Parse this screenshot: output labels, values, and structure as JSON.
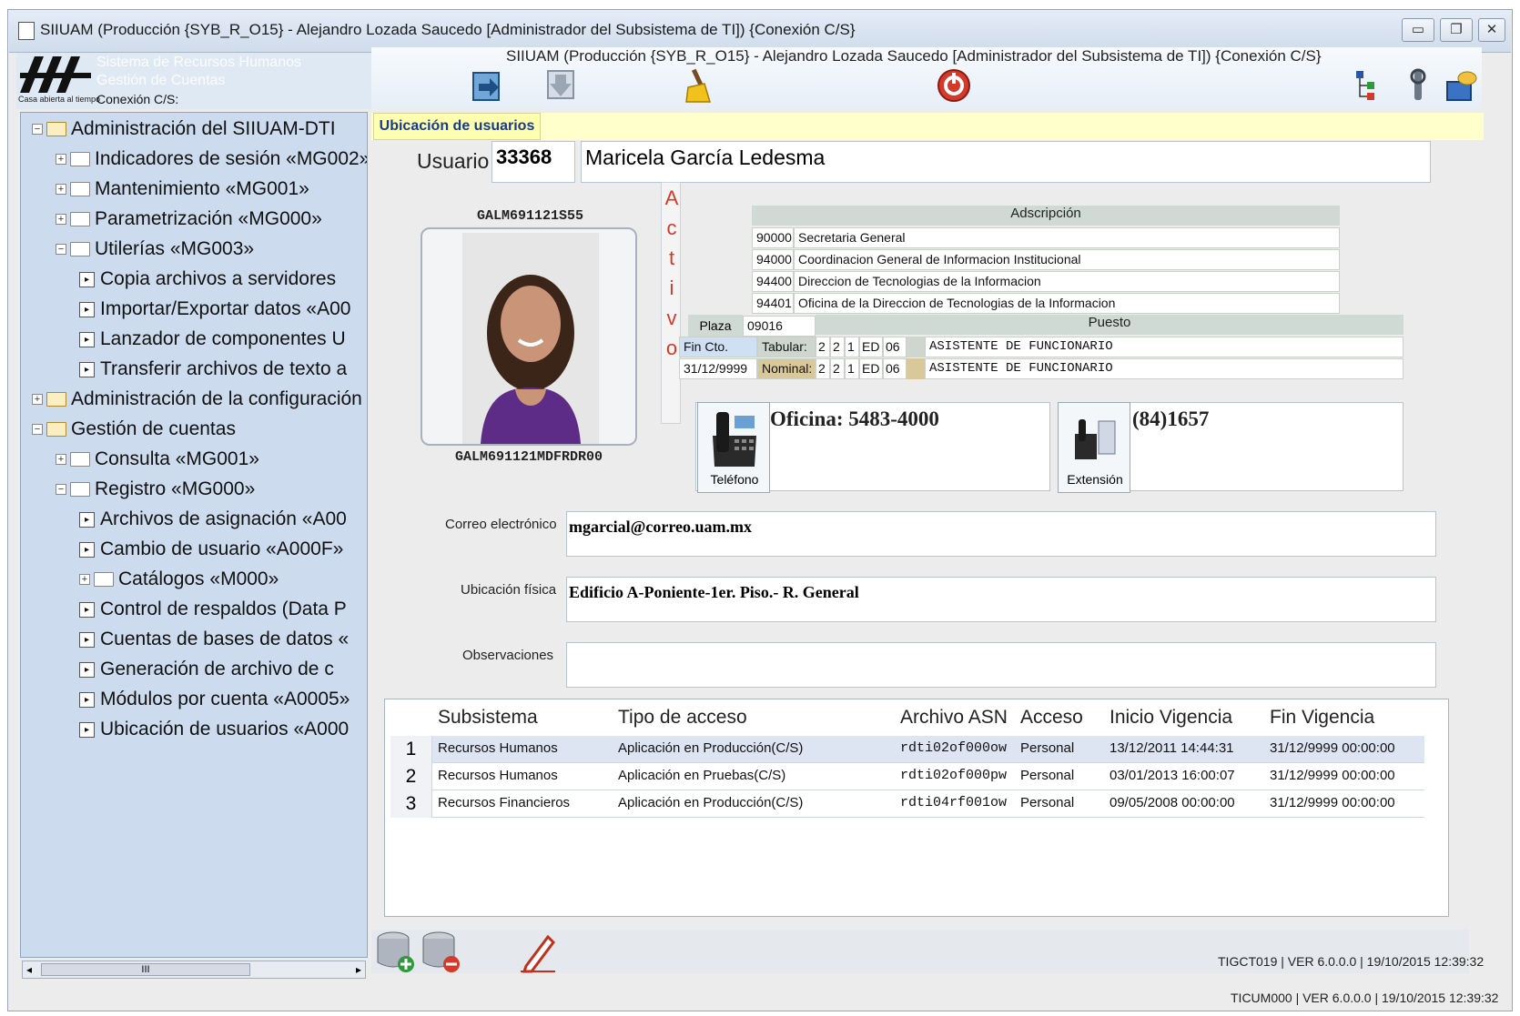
{
  "window": {
    "title": "SIIUAM (Producción {SYB_R_O15} - Alejandro Lozada Saucedo [Administrador del Subsistema de TI]) {Conexión C/S}",
    "controls": [
      "minimize-icon",
      "restore-icon",
      "close-icon"
    ]
  },
  "header": {
    "logo_sub": "Casa abierta al tiempo",
    "sistema": "Sistema de Recursos Humanos",
    "gestion": "Gestión de Cuentas",
    "conexion": "Conexión C/S:",
    "subtitle": "SIIUAM (Producción {SYB_R_O15} - Alejandro Lozada Saucedo [Administrador del Subsistema de TI]) {Conexión C/S}"
  },
  "toolbar": {
    "icons": [
      "import-icon",
      "export-icon",
      "broom-icon",
      "stop-icon",
      "tree-icon",
      "tools-icon",
      "network-icon"
    ]
  },
  "tree": [
    {
      "label": "Administración del SIIUAM-DTI",
      "level": 0,
      "type": "open-folder",
      "expander": "−"
    },
    {
      "label": "Indicadores de sesión «MG002»",
      "level": 1,
      "type": "folder",
      "expander": "+"
    },
    {
      "label": "Mantenimiento «MG001»",
      "level": 1,
      "type": "folder",
      "expander": "+"
    },
    {
      "label": "Parametrización «MG000»",
      "level": 1,
      "type": "folder",
      "expander": "+"
    },
    {
      "label": "Utilerías «MG003»",
      "level": 1,
      "type": "folder",
      "expander": "−"
    },
    {
      "label": "Copia archivos a servidores",
      "level": 2,
      "type": "leaf"
    },
    {
      "label": "Importar/Exportar datos «A00",
      "level": 2,
      "type": "leaf"
    },
    {
      "label": "Lanzador de componentes U",
      "level": 2,
      "type": "leaf"
    },
    {
      "label": "Transferir archivos de texto a",
      "level": 2,
      "type": "leaf"
    },
    {
      "label": "Administración de la configuración",
      "level": 0,
      "type": "open-folder",
      "expander": "+"
    },
    {
      "label": "Gestión de cuentas",
      "level": 0,
      "type": "open-folder",
      "expander": "−"
    },
    {
      "label": "Consulta «MG001»",
      "level": 1,
      "type": "folder",
      "expander": "+"
    },
    {
      "label": "Registro «MG000»",
      "level": 1,
      "type": "folder",
      "expander": "−"
    },
    {
      "label": "Archivos de asignación «A00",
      "level": 2,
      "type": "leaf"
    },
    {
      "label": "Cambio de usuario «A000F»",
      "level": 2,
      "type": "leaf"
    },
    {
      "label": "Catálogos «M000»",
      "level": 2,
      "type": "folder",
      "expander": "+"
    },
    {
      "label": "Control de respaldos (Data P",
      "level": 2,
      "type": "leaf"
    },
    {
      "label": "Cuentas de bases de datos «",
      "level": 2,
      "type": "leaf"
    },
    {
      "label": "Generación de archivo de c",
      "level": 2,
      "type": "leaf"
    },
    {
      "label": "Módulos por cuenta «A0005»",
      "level": 2,
      "type": "leaf"
    },
    {
      "label": "Ubicación de usuarios «A000",
      "level": 2,
      "type": "leaf"
    }
  ],
  "tab": {
    "label": "Ubicación de usuarios"
  },
  "usuario": {
    "label": "Usuario",
    "number": "33368",
    "name": "Maricela García Ledesma",
    "rfc": "GALM691121S55",
    "curp": "GALM691121MDFRDR00",
    "status_letters": [
      "A",
      "c",
      "t",
      "i",
      "v",
      "o"
    ]
  },
  "adscripcion": {
    "header": "Adscripción",
    "rows": [
      {
        "code": "90000",
        "name": "Secretaria General"
      },
      {
        "code": "94000",
        "name": "Coordinacion General de Informacion Institucional"
      },
      {
        "code": "94400",
        "name": "Direccion de Tecnologias de la Informacion"
      },
      {
        "code": "94401",
        "name": "Oficina de la Direccion de Tecnologias de la Informacion"
      }
    ]
  },
  "plaza": {
    "label": "Plaza",
    "value": "09016",
    "puesto_header": "Puesto",
    "fin_cto_label": "Fin Cto.",
    "fin_cto_value": "31/12/9999",
    "tabular_label": "Tabular:",
    "nominal_label": "Nominal:",
    "tabular_codes": [
      "2",
      "2",
      "1",
      "ED",
      "06"
    ],
    "nominal_codes": [
      "2",
      "2",
      "1",
      "ED",
      "06"
    ],
    "tabular_puesto": "ASISTENTE DE FUNCIONARIO",
    "nominal_puesto": "ASISTENTE DE FUNCIONARIO"
  },
  "telefono": {
    "caption": "Teléfono",
    "value": "Oficina: 5483-4000"
  },
  "extension": {
    "caption": "Extensión",
    "value": "(84)1657"
  },
  "correo": {
    "label": "Correo electrónico",
    "value": "mgarcial@correo.uam.mx"
  },
  "ubicacion": {
    "label": "Ubicación física",
    "value": "Edificio A-Poniente-1er. Piso.- R. General"
  },
  "observaciones": {
    "label": "Observaciones",
    "value": ""
  },
  "accesos": {
    "columns": [
      "Subsistema",
      "Tipo de acceso",
      "Archivo ASN",
      "Acceso",
      "Inicio Vigencia",
      "Fin Vigencia"
    ],
    "rows": [
      {
        "n": "1",
        "sub": "Recursos Humanos",
        "tipo": "Aplicación en Producción(C/S)",
        "asn": "rdti02of000ow",
        "acceso": "Personal",
        "inicio": "13/12/2011 14:44:31",
        "fin": "31/12/9999 00:00:00"
      },
      {
        "n": "2",
        "sub": "Recursos Humanos",
        "tipo": "Aplicación en Pruebas(C/S)",
        "asn": "rdti02of000pw",
        "acceso": "Personal",
        "inicio": "03/01/2013 16:00:07",
        "fin": "31/12/9999 00:00:00"
      },
      {
        "n": "3",
        "sub": "Recursos Financieros",
        "tipo": "Aplicación en Producción(C/S)",
        "asn": "rdti04rf001ow",
        "acceso": "Personal",
        "inicio": "09/05/2008 00:00:00",
        "fin": "31/12/9999 00:00:00"
      }
    ]
  },
  "bottom_icons": [
    "db-add-icon",
    "db-remove-icon",
    "edit-icon"
  ],
  "status": {
    "inner": "TIGCT019 | VER 6.0.0.0 | 19/10/2015 12:39:32",
    "outer": "TICUM000 | VER 6.0.0.0 | 19/10/2015 12:39:32"
  },
  "scrollbar_glyph": "III",
  "colors": {
    "tree_bg": "#ccdcee",
    "tab_bg": "#ffffb0",
    "grid_header": "#cfdad4",
    "status_red": "#d43a2a"
  }
}
